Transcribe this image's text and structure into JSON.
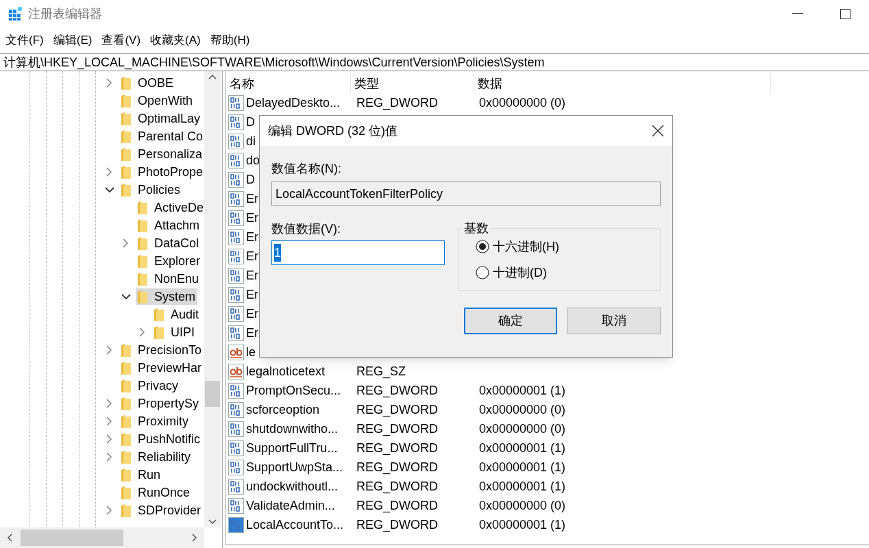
{
  "window": {
    "title": "注册表编辑器"
  },
  "menu": [
    "文件(F)",
    "编辑(E)",
    "查看(V)",
    "收藏夹(A)",
    "帮助(H)"
  ],
  "address": "计算机\\HKEY_LOCAL_MACHINE\\SOFTWARE\\Microsoft\\Windows\\CurrentVersion\\Policies\\System",
  "tree": [
    {
      "label": "OOBE",
      "expandable": true,
      "expanded": false,
      "selected": false
    },
    {
      "label": "OpenWith",
      "expandable": false,
      "selected": false
    },
    {
      "label": "OptimalLay",
      "expandable": false,
      "selected": false
    },
    {
      "label": "Parental Co",
      "expandable": false,
      "selected": false
    },
    {
      "label": "Personaliza",
      "expandable": false,
      "selected": false
    },
    {
      "label": "PhotoPrope",
      "expandable": true,
      "expanded": false,
      "selected": false
    },
    {
      "label": "Policies",
      "expandable": true,
      "expanded": true,
      "selected": false,
      "children": [
        {
          "label": "ActiveDe",
          "expandable": false,
          "selected": false
        },
        {
          "label": "Attachm",
          "expandable": false,
          "selected": false
        },
        {
          "label": "DataCol",
          "expandable": true,
          "expanded": false,
          "selected": false
        },
        {
          "label": "Explorer",
          "expandable": false,
          "selected": false
        },
        {
          "label": "NonEnu",
          "expandable": false,
          "selected": false
        },
        {
          "label": "System",
          "expandable": true,
          "expanded": true,
          "selected": true,
          "children": [
            {
              "label": "Audit",
              "expandable": false,
              "selected": false
            },
            {
              "label": "UIPI",
              "expandable": true,
              "expanded": false,
              "selected": false
            }
          ]
        }
      ]
    },
    {
      "label": "PrecisionTo",
      "expandable": true,
      "expanded": false,
      "selected": false
    },
    {
      "label": "PreviewHar",
      "expandable": false,
      "selected": false
    },
    {
      "label": "Privacy",
      "expandable": false,
      "selected": false
    },
    {
      "label": "PropertySy",
      "expandable": true,
      "expanded": false,
      "selected": false
    },
    {
      "label": "Proximity",
      "expandable": true,
      "expanded": false,
      "selected": false
    },
    {
      "label": "PushNotific",
      "expandable": true,
      "expanded": false,
      "selected": false
    },
    {
      "label": "Reliability",
      "expandable": true,
      "expanded": false,
      "selected": false
    },
    {
      "label": "Run",
      "expandable": false,
      "selected": false
    },
    {
      "label": "RunOnce",
      "expandable": false,
      "selected": false
    },
    {
      "label": "SDProvider",
      "expandable": true,
      "expanded": false,
      "selected": false
    }
  ],
  "list": {
    "columns": [
      "名称",
      "类型",
      "数据"
    ],
    "rows": [
      {
        "kind": "dword",
        "name": "DelayedDeskto...",
        "type": "REG_DWORD",
        "data": "0x00000000 (0)",
        "selected": false
      },
      {
        "kind": "dword",
        "name": "D",
        "selected": false
      },
      {
        "kind": "dword",
        "name": "di",
        "selected": false
      },
      {
        "kind": "dword",
        "name": "do",
        "selected": false
      },
      {
        "kind": "dword",
        "name": "D",
        "selected": false
      },
      {
        "kind": "dword",
        "name": "Er",
        "selected": false
      },
      {
        "kind": "dword",
        "name": "Er",
        "selected": false
      },
      {
        "kind": "dword",
        "name": "Er",
        "selected": false
      },
      {
        "kind": "dword",
        "name": "Er",
        "selected": false
      },
      {
        "kind": "dword",
        "name": "Er",
        "selected": false
      },
      {
        "kind": "dword",
        "name": "Er",
        "selected": false
      },
      {
        "kind": "dword",
        "name": "Er",
        "selected": false
      },
      {
        "kind": "dword",
        "name": "Er",
        "selected": false
      },
      {
        "kind": "string",
        "name": "le",
        "selected": false
      },
      {
        "kind": "string",
        "name": "legalnoticetext",
        "type": "REG_SZ",
        "selected": false
      },
      {
        "kind": "dword",
        "name": "PromptOnSecu...",
        "type": "REG_DWORD",
        "data": "0x00000001 (1)",
        "selected": false
      },
      {
        "kind": "dword",
        "name": "scforceoption",
        "type": "REG_DWORD",
        "data": "0x00000000 (0)",
        "selected": false
      },
      {
        "kind": "dword",
        "name": "shutdownwitho...",
        "type": "REG_DWORD",
        "data": "0x00000000 (0)",
        "selected": false
      },
      {
        "kind": "dword",
        "name": "SupportFullTru...",
        "type": "REG_DWORD",
        "data": "0x00000001 (1)",
        "selected": false
      },
      {
        "kind": "dword",
        "name": "SupportUwpSta...",
        "type": "REG_DWORD",
        "data": "0x00000001 (1)",
        "selected": false
      },
      {
        "kind": "dword",
        "name": "undockwithoutl...",
        "type": "REG_DWORD",
        "data": "0x00000001 (1)",
        "selected": false
      },
      {
        "kind": "dword",
        "name": "ValidateAdmin...",
        "type": "REG_DWORD",
        "data": "0x00000000 (0)",
        "selected": false
      },
      {
        "kind": "dword",
        "name": "LocalAccountTo...",
        "type": "REG_DWORD",
        "data": "0x00000001 (1)",
        "selected": true
      }
    ]
  },
  "dialog": {
    "title": "编辑 DWORD (32 位)值",
    "name_label": "数值名称(N):",
    "name_value": "LocalAccountTokenFilterPolicy",
    "data_label": "数值数据(V):",
    "data_value": "1",
    "base_label": "基数",
    "bases": [
      {
        "label": "十六进制(H)",
        "selected": true
      },
      {
        "label": "十进制(D)",
        "selected": false
      }
    ],
    "buttons": [
      {
        "label": "确定",
        "default": true
      },
      {
        "label": "取消",
        "default": false
      }
    ]
  }
}
